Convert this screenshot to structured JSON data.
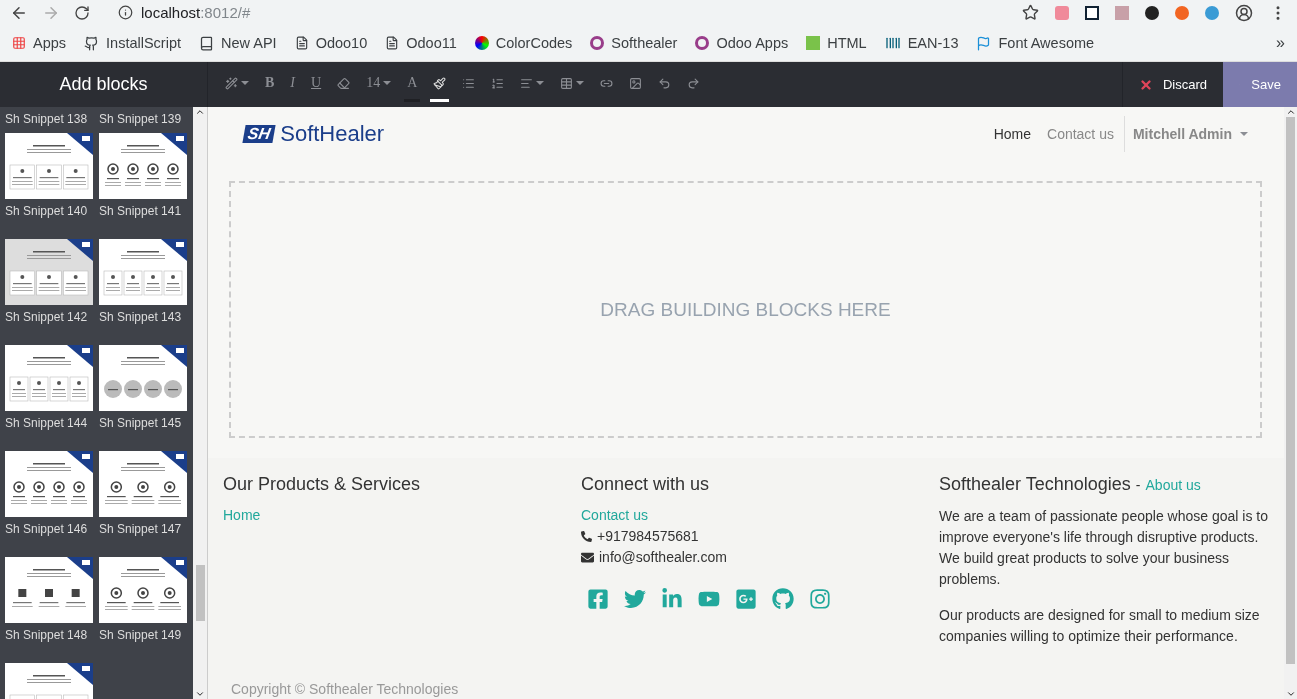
{
  "browser": {
    "url_host": "localhost",
    "url_rest": ":8012/#",
    "bookmarks": [
      {
        "label": "Apps"
      },
      {
        "label": "InstallScript"
      },
      {
        "label": "New API"
      },
      {
        "label": "Odoo10"
      },
      {
        "label": "Odoo11"
      },
      {
        "label": "ColorCodes"
      },
      {
        "label": "Softhealer"
      },
      {
        "label": "Odoo Apps"
      },
      {
        "label": "HTML"
      },
      {
        "label": "EAN-13"
      },
      {
        "label": "Font Awesome"
      }
    ],
    "more": "»"
  },
  "editor": {
    "title": "Add blocks",
    "toolbar": [
      {
        "kind": "magic",
        "caret": true
      },
      {
        "kind": "bold",
        "label": "B"
      },
      {
        "kind": "italic",
        "label": "I"
      },
      {
        "kind": "underline",
        "label": "U"
      },
      {
        "kind": "eraser"
      },
      {
        "kind": "size",
        "label": "14",
        "caret": true
      },
      {
        "kind": "forecolor",
        "label": "A"
      },
      {
        "kind": "brush",
        "selected": true
      },
      {
        "kind": "bullets"
      },
      {
        "kind": "numbers"
      },
      {
        "kind": "align",
        "caret": true
      },
      {
        "kind": "table",
        "caret": true
      },
      {
        "kind": "link"
      },
      {
        "kind": "image"
      },
      {
        "kind": "undo"
      },
      {
        "kind": "redo"
      }
    ],
    "discard": "Discard",
    "save": "Save"
  },
  "sidebar": {
    "snippets": [
      {
        "kind": "label_only",
        "label": "Sh Snippet 138"
      },
      {
        "kind": "label_only",
        "label": "Sh Snippet 139"
      },
      {
        "kind": "full",
        "label": "Sh Snippet 140",
        "hovered": false
      },
      {
        "kind": "full",
        "label": "Sh Snippet 141",
        "hovered": false
      },
      {
        "kind": "full",
        "label": "Sh Snippet 142",
        "hovered": true
      },
      {
        "kind": "full",
        "label": "Sh Snippet 143",
        "hovered": false
      },
      {
        "kind": "full",
        "label": "Sh Snippet 144",
        "hovered": false
      },
      {
        "kind": "full",
        "label": "Sh Snippet 145",
        "hovered": false
      },
      {
        "kind": "full",
        "label": "Sh Snippet 146",
        "hovered": false
      },
      {
        "kind": "full",
        "label": "Sh Snippet 147",
        "hovered": false
      },
      {
        "kind": "full",
        "label": "Sh Snippet 148",
        "hovered": false
      },
      {
        "kind": "full",
        "label": "Sh Snippet 149",
        "hovered": false
      },
      {
        "kind": "thumb_only",
        "hovered": false
      }
    ]
  },
  "site": {
    "logo_mark": "SH",
    "logo_text": "SoftHealer",
    "nav": [
      {
        "label": "Home",
        "selected": true
      },
      {
        "label": "Contact us",
        "selected": false
      }
    ],
    "user": "Mitchell Admin",
    "dropzone": "DRAG BUILDING BLOCKS HERE",
    "footer": {
      "col1": {
        "title": "Our Products & Services",
        "links": [
          "Home"
        ]
      },
      "col2": {
        "title": "Connect with us",
        "link": "Contact us",
        "phone": "+917984575681",
        "email": "info@softhealer.com"
      },
      "col3": {
        "title": "Softhealer Technologies",
        "sep": "-",
        "link": "About us",
        "paragraphs": [
          "We are a team of passionate people whose goal is to improve everyone's life through disruptive products. We build great products to solve your business problems.",
          "Our products are designed for small to medium size companies willing to optimize their performance."
        ]
      },
      "copyright": "Copyright © Softhealer Technologies"
    }
  }
}
